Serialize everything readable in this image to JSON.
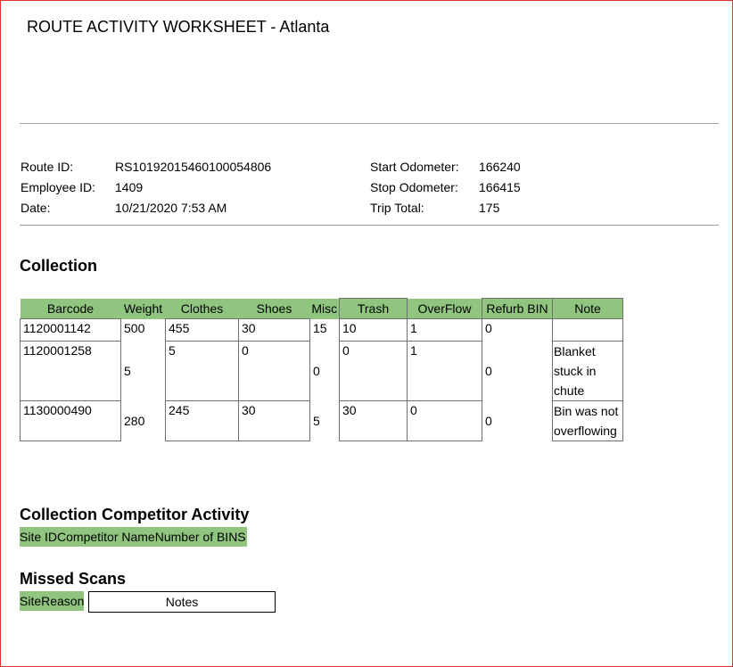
{
  "header": {
    "title": "ROUTE ACTIVITY WORKSHEET - Atlanta"
  },
  "route": {
    "route_id_label": "Route ID:",
    "route_id": "RS10192015460100054806",
    "employee_id_label": "Employee ID:",
    "employee_id": "1409",
    "date_label": "Date:",
    "date": "10/21/2020 7:53 AM",
    "start_odometer_label": "Start Odometer:",
    "start_odometer": "166240",
    "stop_odometer_label": "Stop Odometer:",
    "stop_odometer": "166415",
    "trip_total_label": "Trip Total:",
    "trip_total": "175"
  },
  "collection": {
    "heading": "Collection",
    "columns": [
      "Barcode",
      "Weight",
      "Clothes",
      "Shoes",
      "Misc",
      "Trash",
      "OverFlow",
      "Refurb BIN",
      "Note"
    ],
    "rows": [
      {
        "barcode": "1120001142",
        "weight": "500",
        "clothes": "455",
        "shoes": "30",
        "misc": "15",
        "trash": "10",
        "overflow": "1",
        "refurb": "0",
        "note": ""
      },
      {
        "barcode": "1120001258",
        "weight": "5",
        "clothes": "5",
        "shoes": "0",
        "misc": "0",
        "trash": "0",
        "overflow": "1",
        "refurb": "0",
        "note": "Blanket stuck in chute"
      },
      {
        "barcode": "1130000490",
        "weight": "280",
        "clothes": "245",
        "shoes": "30",
        "misc": "5",
        "trash": "30",
        "overflow": "0",
        "refurb": "0",
        "note": "Bin was not overflowing"
      }
    ]
  },
  "competitor": {
    "heading": "Collection Competitor Activity",
    "col_site_id": "Site ID",
    "col_competitor_name": "Competitor Name",
    "col_number_of_bins": "Number of BINS"
  },
  "missed_scans": {
    "heading": "Missed Scans",
    "col_site": "Site",
    "col_reason": "Reason",
    "col_notes": "Notes"
  },
  "colors": {
    "header_green": "#8fc57e",
    "frame_red": "#e03030"
  }
}
